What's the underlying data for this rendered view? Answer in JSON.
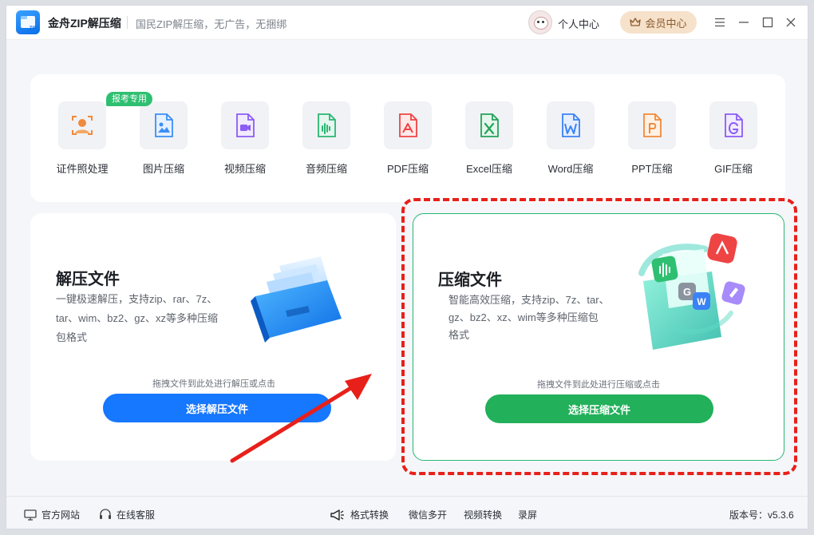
{
  "app": {
    "title": "金舟ZIP解压缩",
    "slogan": "国民ZIP解压缩，无广告，无捆绑",
    "user_center": "个人中心",
    "vip_center": "会员中心"
  },
  "features": {
    "badge": "报考专用",
    "items": [
      {
        "label": "证件照处理",
        "icon": "id-photo-icon",
        "color": "#f08a3c"
      },
      {
        "label": "图片压缩",
        "icon": "image-icon",
        "color": "#3b8ff6"
      },
      {
        "label": "视频压缩",
        "icon": "video-icon",
        "color": "#8b5cf6"
      },
      {
        "label": "音频压缩",
        "icon": "audio-icon",
        "color": "#2bb673"
      },
      {
        "label": "PDF压缩",
        "icon": "pdf-icon",
        "color": "#ef4444"
      },
      {
        "label": "Excel压缩",
        "icon": "excel-icon",
        "color": "#22a35a"
      },
      {
        "label": "Word压缩",
        "icon": "word-icon",
        "color": "#3b82f6"
      },
      {
        "label": "PPT压缩",
        "icon": "ppt-icon",
        "color": "#f08a3c"
      },
      {
        "label": "GIF压缩",
        "icon": "gif-icon",
        "color": "#8b5cf6"
      }
    ]
  },
  "extract": {
    "title": "解压文件",
    "desc_line1": "一键极速解压，支持zip、rar、7z、",
    "desc_line2": "tar、wim、bz2、gz、xz等多种压缩",
    "desc_line3": "包格式",
    "hint": "拖拽文件到此处进行解压或点击",
    "button": "选择解压文件"
  },
  "compress": {
    "title": "压缩文件",
    "desc_line1": "智能高效压缩，支持zip、7z、tar、",
    "desc_line2": "gz、bz2、xz、wim等多种压缩包",
    "desc_line3": "格式",
    "hint": "拖拽文件到此处进行压缩或点击",
    "button": "选择压缩文件"
  },
  "footer": {
    "official_site": "官方网站",
    "online_service": "在线客服",
    "format_convert": "格式转换",
    "wechat_multi": "微信多开",
    "video_convert": "视频转换",
    "screen_record": "录屏",
    "version": "版本号：v5.3.6"
  },
  "colors": {
    "accent_blue": "#1677ff",
    "accent_green": "#22b05a",
    "annotation_red": "#e8201a"
  }
}
